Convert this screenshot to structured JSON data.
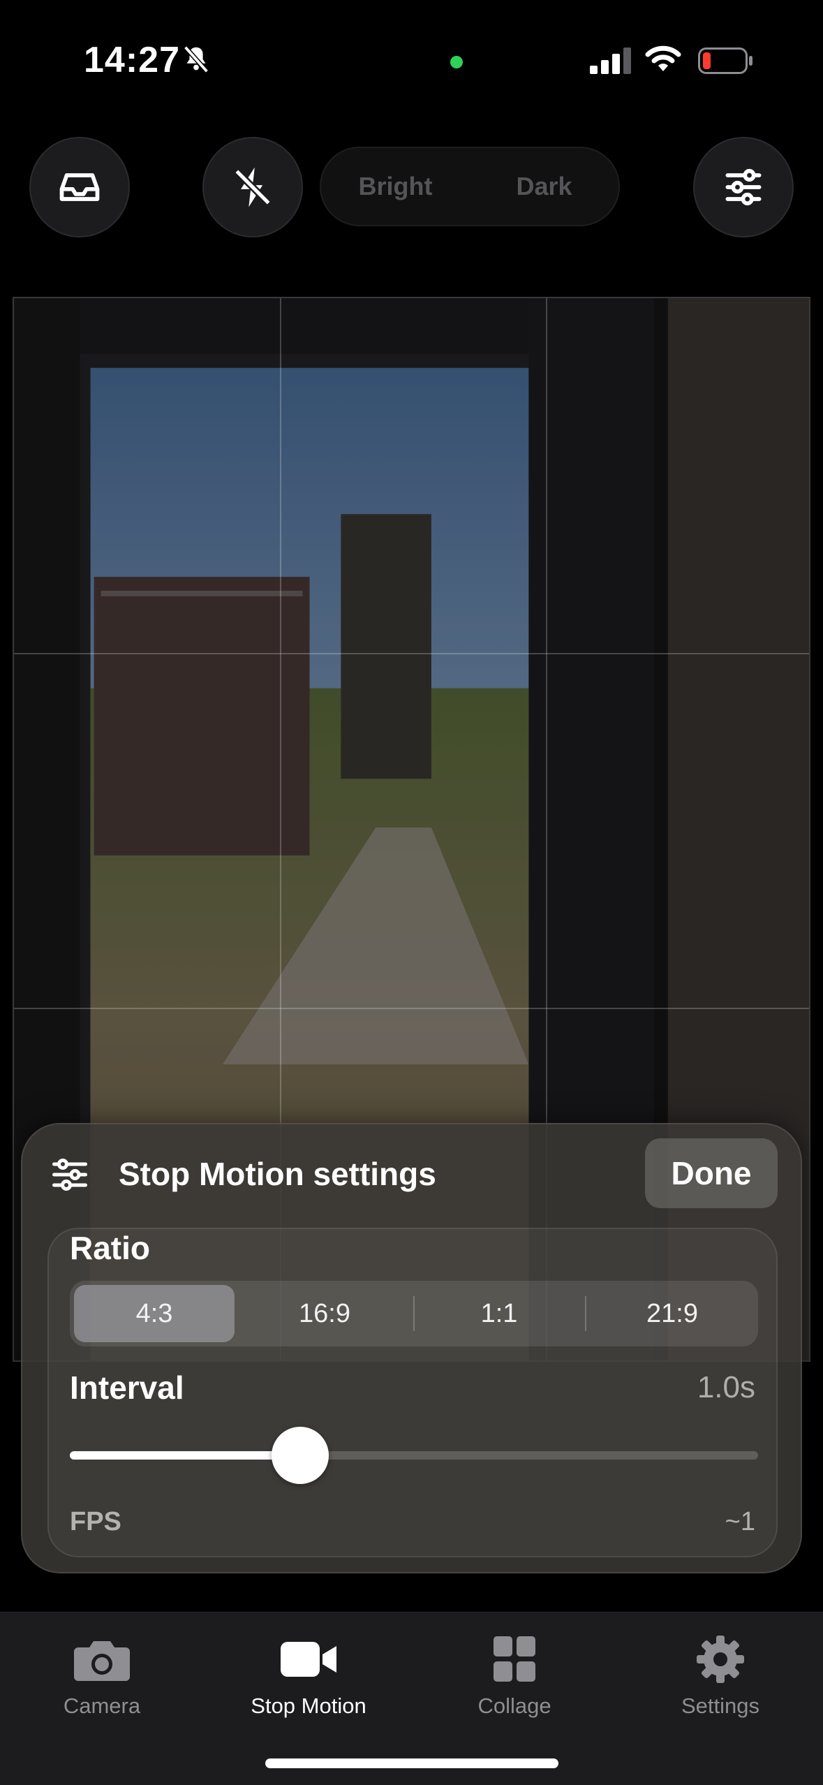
{
  "status_bar": {
    "time": "14:27"
  },
  "top_controls": {
    "icons": [
      "inbox-icon",
      "flash-off-icon",
      "sliders-icon"
    ],
    "mode_options": [
      "Bright",
      "Dark"
    ]
  },
  "settings_sheet": {
    "title": "Stop Motion settings",
    "done_label": "Done",
    "ratio_label": "Ratio",
    "ratio_options": [
      "4:3",
      "16:9",
      "1:1",
      "21:9"
    ],
    "ratio_selected": "4:3",
    "interval_label": "Interval",
    "interval_value": "1.0s",
    "interval_slider_fraction": 0.335,
    "fps_label": "FPS",
    "fps_value": "~1"
  },
  "tab_bar": {
    "tabs": [
      {
        "label": "Camera",
        "icon": "camera-icon"
      },
      {
        "label": "Stop Motion",
        "icon": "video-camera-icon"
      },
      {
        "label": "Collage",
        "icon": "grid-icon"
      },
      {
        "label": "Settings",
        "icon": "gear-icon"
      }
    ],
    "active": "Stop Motion"
  },
  "colors": {
    "accent": "#ffffff",
    "camera_indicator": "#2fd158",
    "battery_low": "#ff3b30"
  }
}
